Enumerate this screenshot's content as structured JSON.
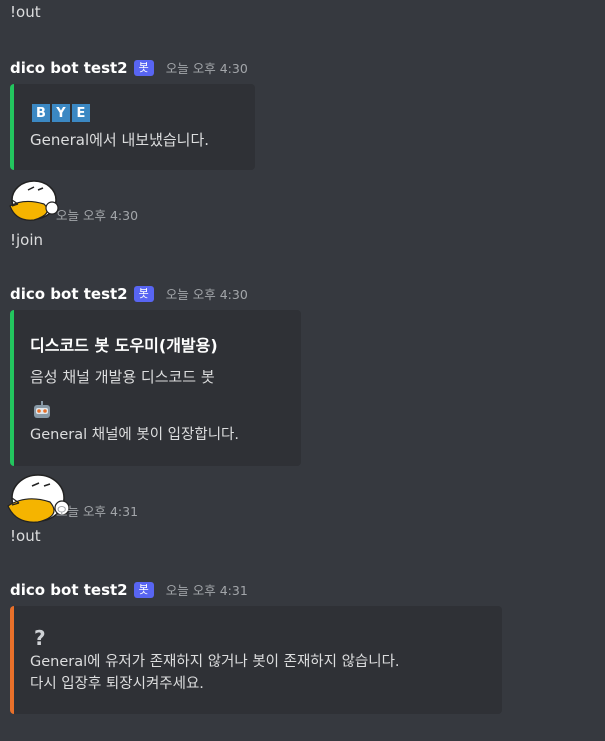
{
  "messages": {
    "m1": {
      "text": "!out"
    },
    "m2": {
      "author": "dico bot test2",
      "tag": "봇",
      "time": "오늘 오후 4:30",
      "embed": {
        "bye": [
          "B",
          "Y",
          "E"
        ],
        "line": "General에서 내보냈습니다."
      }
    },
    "m3": {
      "time": "오늘 오후 4:30",
      "text": "!join"
    },
    "m4": {
      "author": "dico bot test2",
      "tag": "봇",
      "time": "오늘 오후 4:30",
      "embed": {
        "title": "디스코드 봇 도우미(개발용)",
        "desc": "음성 채널 개발용 디스코드 봇",
        "icon": "robot-icon",
        "line": "General 채널에 봇이 입장합니다."
      }
    },
    "m5": {
      "time": "오늘 오후 4:31",
      "text": "!out"
    },
    "m6": {
      "author": "dico bot test2",
      "tag": "봇",
      "time": "오늘 오후 4:31",
      "embed": {
        "icon": "question-icon",
        "line1": "General에 유저가 존재하지 않거나 봇이 존재하지 않습니다.",
        "line2": "다시 입장후 퇴장시켜주세요."
      }
    }
  },
  "colors": {
    "background": "#36393f",
    "embed": "#2f3136",
    "green": "#23c55e",
    "orange": "#e8702a",
    "bot_tag": "#5865f2"
  },
  "icons": [
    "robot-icon",
    "question-icon",
    "avatar-duck"
  ]
}
